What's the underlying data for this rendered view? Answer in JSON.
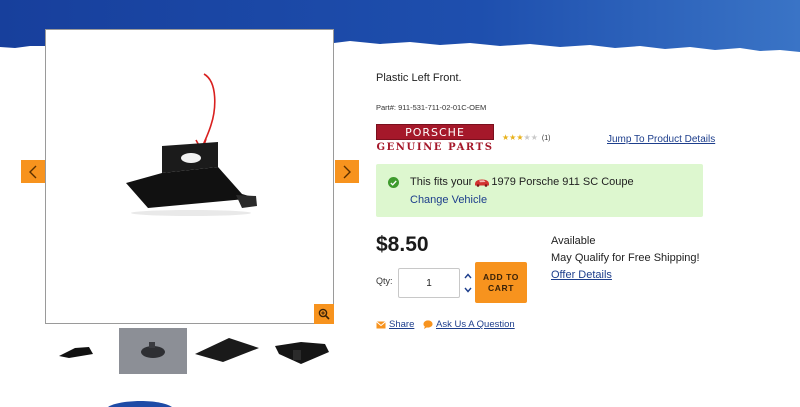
{
  "colors": {
    "banner_blue": "#1e4ba6",
    "accent_orange": "#f7931e",
    "link_blue": "#1d3e8c",
    "fit_green_bg": "#ddf7cf",
    "brand_red": "#a5182a"
  },
  "gallery": {
    "prev_icon": "chevron-left-icon",
    "next_icon": "chevron-right-icon",
    "zoom_icon": "zoom-in-icon",
    "thumbnail_count": 4
  },
  "product": {
    "title": "Plastic Left Front.",
    "part_label": "Part#:",
    "part_number": "911-531-711-02-01C-OEM",
    "brand_top": "PORSCHE",
    "brand_bottom": "GENUINE PARTS",
    "rating": 3,
    "rating_max": 5,
    "review_count": "(1)",
    "jump_link": "Jump To Product Details"
  },
  "fitment": {
    "prefix": "This fits your",
    "vehicle": "1979 Porsche 911 SC Coupe",
    "change_link": "Change Vehicle"
  },
  "purchase": {
    "price": "$8.50",
    "qty_label": "Qty:",
    "qty_value": "1",
    "add_to_cart_line1": "ADD TO",
    "add_to_cart_line2": "CART",
    "availability": "Available",
    "shipping_note": "May Qualify for Free Shipping!",
    "offer_link": "Offer Details"
  },
  "social": {
    "share": "Share",
    "ask": "Ask Us A Question"
  }
}
